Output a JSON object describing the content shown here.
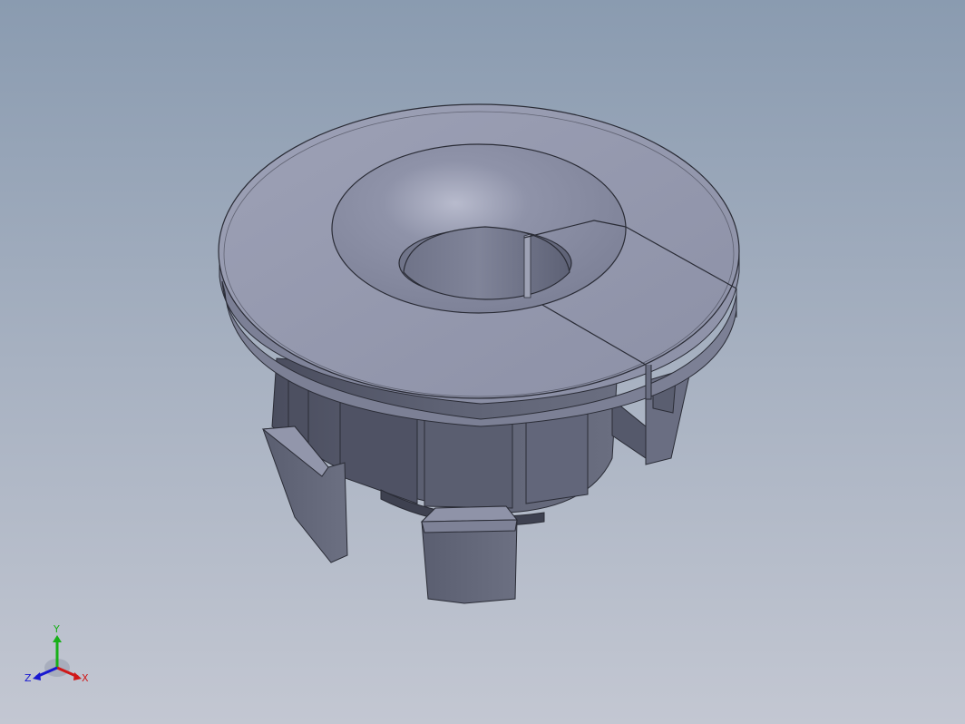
{
  "viewport": {
    "background_top": "#8a9bb0",
    "background_bottom": "#c3c7d2",
    "part_color": "#8f93a8"
  },
  "triad": {
    "x_label": "X",
    "y_label": "Y",
    "z_label": "Z",
    "x_color": "#d01818",
    "y_color": "#18b018",
    "z_color": "#1818d0"
  }
}
